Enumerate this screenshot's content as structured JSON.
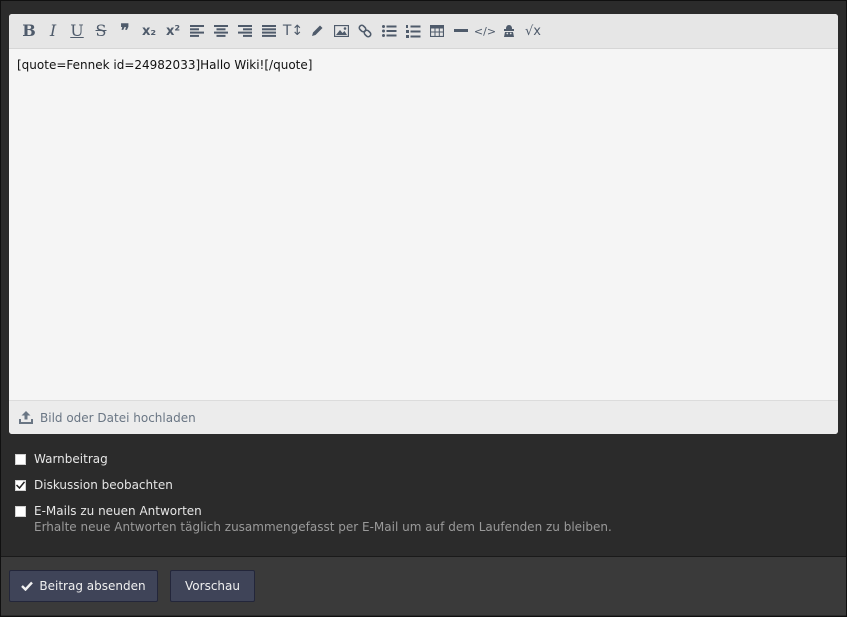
{
  "toolbar": {
    "items": [
      {
        "icon": "bold-icon",
        "glyph": "B"
      },
      {
        "icon": "italic-icon",
        "glyph": "I"
      },
      {
        "icon": "underline-icon",
        "glyph": "U"
      },
      {
        "icon": "strikethrough-icon",
        "glyph": "S"
      },
      {
        "icon": "quote-icon",
        "glyph": "❞"
      },
      {
        "icon": "subscript-icon",
        "glyph": "x₂"
      },
      {
        "icon": "superscript-icon",
        "glyph": "x²"
      },
      {
        "icon": "align-left-icon"
      },
      {
        "icon": "align-center-icon"
      },
      {
        "icon": "align-right-icon"
      },
      {
        "icon": "align-justify-icon"
      },
      {
        "icon": "font-size-icon",
        "glyph": "T↕"
      },
      {
        "icon": "pencil-icon"
      },
      {
        "icon": "image-icon"
      },
      {
        "icon": "link-icon"
      },
      {
        "icon": "bullet-list-icon"
      },
      {
        "icon": "numbered-list-icon"
      },
      {
        "icon": "table-icon"
      },
      {
        "icon": "horizontal-rule-icon"
      },
      {
        "icon": "code-icon",
        "glyph": "</>"
      },
      {
        "icon": "spoiler-icon"
      },
      {
        "icon": "math-icon",
        "glyph": "√x"
      }
    ]
  },
  "editor": {
    "content": "[quote=Fennek id=24982033]Hallo Wiki![/quote]"
  },
  "upload": {
    "label": "Bild oder Datei hochladen",
    "icon": "upload-icon"
  },
  "options": {
    "warn": {
      "label": "Warnbeitrag",
      "checked": false
    },
    "watch": {
      "label": "Diskussion beobachten",
      "checked": true
    },
    "emails": {
      "label": "E-Mails zu neuen Antworten",
      "checked": false,
      "hint": "Erhalte neue Antworten täglich zusammengefasst per E-Mail um auf dem Laufenden zu bleiben."
    }
  },
  "footer": {
    "submit_label": "Beitrag absenden",
    "submit_icon": "check-icon",
    "preview_label": "Vorschau"
  },
  "colors": {
    "background": "#2b2b2b",
    "editor_bg": "#f5f5f5",
    "toolbar_bg": "#e6e6e6",
    "icon_color": "#4f5b6b",
    "button_bg": "#3f4458"
  }
}
